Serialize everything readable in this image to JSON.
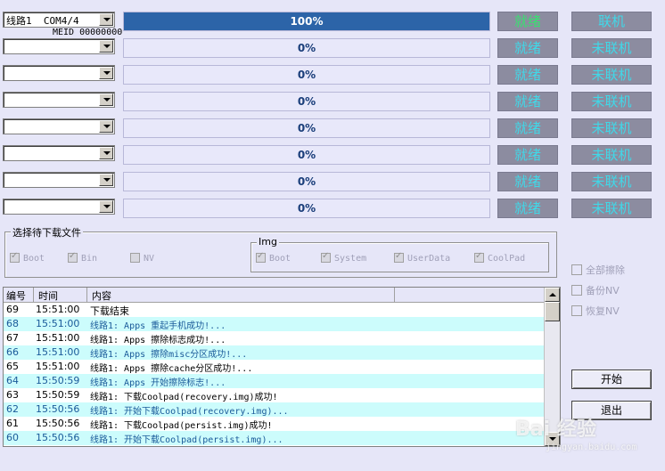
{
  "lines": [
    {
      "combo": "线路1  COM4/4",
      "meid": "MEID 00000000",
      "progress_label": "100%",
      "progress": 1.0,
      "status": "就绪",
      "conn": "联机"
    },
    {
      "combo": "",
      "progress_label": "0%",
      "progress": 0.0,
      "status": "就绪",
      "conn": "未联机"
    },
    {
      "combo": "",
      "progress_label": "0%",
      "progress": 0.0,
      "status": "就绪",
      "conn": "未联机"
    },
    {
      "combo": "",
      "progress_label": "0%",
      "progress": 0.0,
      "status": "就绪",
      "conn": "未联机"
    },
    {
      "combo": "",
      "progress_label": "0%",
      "progress": 0.0,
      "status": "就绪",
      "conn": "未联机"
    },
    {
      "combo": "",
      "progress_label": "0%",
      "progress": 0.0,
      "status": "就绪",
      "conn": "未联机"
    },
    {
      "combo": "",
      "progress_label": "0%",
      "progress": 0.0,
      "status": "就绪",
      "conn": "未联机"
    },
    {
      "combo": "",
      "progress_label": "0%",
      "progress": 0.0,
      "status": "就绪",
      "conn": "未联机"
    }
  ],
  "file_group": {
    "title": "选择待下载文件",
    "items": [
      {
        "label": "Boot",
        "checked": true
      },
      {
        "label": "Bin",
        "checked": true
      },
      {
        "label": "NV",
        "checked": false
      }
    ],
    "img_group": {
      "title": "Img",
      "items": [
        {
          "label": "Boot",
          "checked": true
        },
        {
          "label": "System",
          "checked": true
        },
        {
          "label": "UserData",
          "checked": true
        },
        {
          "label": "CoolPad",
          "checked": true
        }
      ]
    }
  },
  "options": {
    "erase_all": "全部擦除",
    "backup_nv": "备份NV",
    "restore_nv": "恢复NV"
  },
  "log": {
    "headers": {
      "num": "编号",
      "time": "时间",
      "content": "内容"
    },
    "rows": [
      {
        "num": "69",
        "time": "15:51:00",
        "content": "下载结束"
      },
      {
        "num": "68",
        "time": "15:51:00",
        "content": "线路1: Apps 重起手机成功!..."
      },
      {
        "num": "67",
        "time": "15:51:00",
        "content": "线路1: Apps 擦除标志成功!..."
      },
      {
        "num": "66",
        "time": "15:51:00",
        "content": "线路1: Apps 擦除misc分区成功!..."
      },
      {
        "num": "65",
        "time": "15:51:00",
        "content": "线路1: Apps 擦除cache分区成功!..."
      },
      {
        "num": "64",
        "time": "15:50:59",
        "content": "线路1: Apps 开始擦除标志!..."
      },
      {
        "num": "63",
        "time": "15:50:59",
        "content": "线路1: 下载Coolpad(recovery.img)成功!"
      },
      {
        "num": "62",
        "time": "15:50:56",
        "content": "线路1: 开始下载Coolpad(recovery.img)..."
      },
      {
        "num": "61",
        "time": "15:50:56",
        "content": "线路1: 下载Coolpad(persist.img)成功!"
      },
      {
        "num": "60",
        "time": "15:50:56",
        "content": "线路1: 开始下载Coolpad(persist.img)..."
      }
    ]
  },
  "buttons": {
    "start": "开始",
    "exit": "退出"
  },
  "watermark": {
    "main": "Bai 经验",
    "sub": "jingyan.baidu.com"
  },
  "colors": {
    "progress_fill": "#2c64a8",
    "status_text": "#40d8e8",
    "ready_text": "#38e070",
    "button_bg": "#8c8ca0"
  }
}
